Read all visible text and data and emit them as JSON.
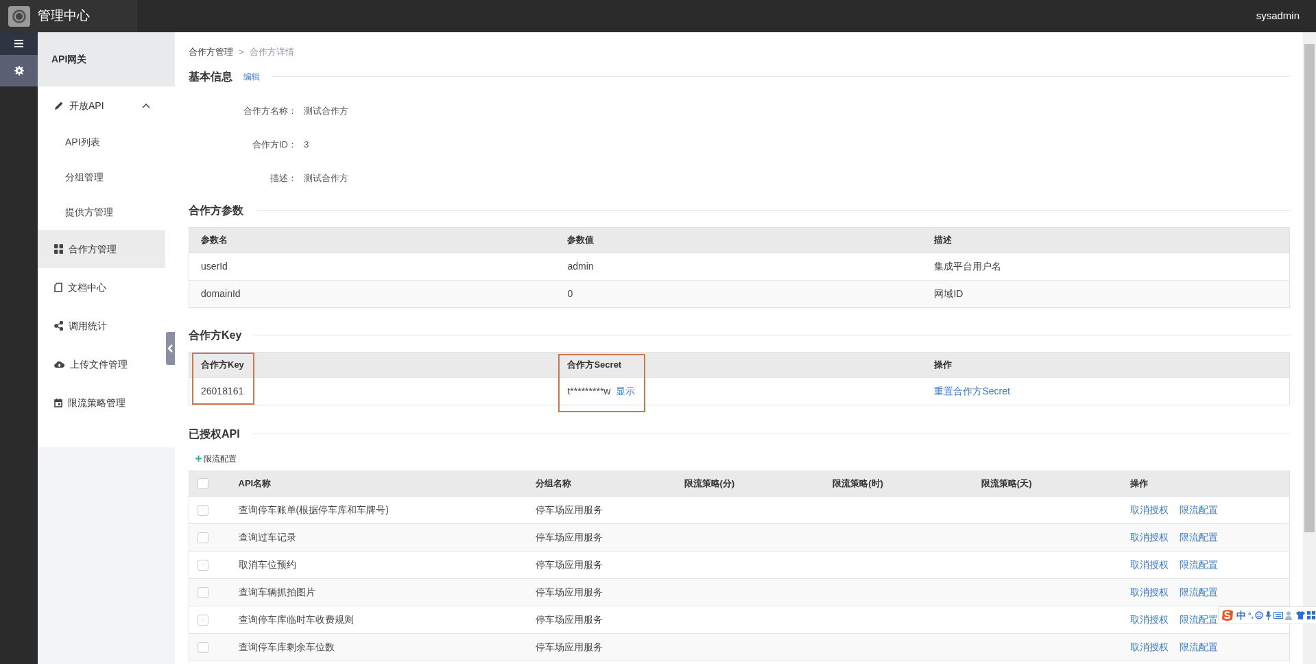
{
  "header": {
    "title": "管理中心",
    "user": "sysadmin"
  },
  "rail": [
    {
      "selected": false
    },
    {
      "selected": true
    }
  ],
  "sidebar": {
    "title": "API网关",
    "items": [
      {
        "label": "开放API",
        "selected": false,
        "expanded": true,
        "children": [
          {
            "label": "API列表",
            "selected": false
          },
          {
            "label": "分组管理",
            "selected": false
          },
          {
            "label": "提供方管理",
            "selected": false
          }
        ]
      },
      {
        "label": "合作方管理",
        "selected": true
      },
      {
        "label": "文档中心",
        "selected": false
      },
      {
        "label": "调用统计",
        "selected": false
      },
      {
        "label": "上传文件管理",
        "selected": false
      },
      {
        "label": "限流策略管理",
        "selected": false
      }
    ]
  },
  "breadcrumb": {
    "separator": ">",
    "items": [
      {
        "label": "合作方管理",
        "current": false
      },
      {
        "label": "合作方详情",
        "current": true
      }
    ]
  },
  "basic_info": {
    "title": "基本信息",
    "action": "编辑",
    "fields": [
      {
        "label": "合作方名称：",
        "value": "测试合作方"
      },
      {
        "label": "合作方ID：",
        "value": "3"
      },
      {
        "label": "描述：",
        "value": "测试合作方"
      }
    ]
  },
  "params": {
    "title": "合作方参数",
    "columns": [
      "参数名",
      "参数值",
      "描述"
    ],
    "rows": [
      [
        "userId",
        "admin",
        "集成平台用户名"
      ],
      [
        "domainId",
        "0",
        "网域ID"
      ]
    ]
  },
  "key_section": {
    "title": "合作方Key",
    "columns": [
      {
        "label": "合作方Key",
        "highlighted": true
      },
      {
        "label": "合作方Secret",
        "highlighted": true
      },
      {
        "label": "操作",
        "highlighted": false
      }
    ],
    "row": {
      "key": "26018161",
      "secret": "t*********w",
      "show": "显示",
      "reset": "重置合作方Secret"
    }
  },
  "authorized": {
    "title": "已授权API",
    "add_button": "限流配置",
    "header_checked": false,
    "columns": [
      "API名称",
      "分组名称",
      "限流策略(分)",
      "限流策略(时)",
      "限流策略(天)",
      "操作"
    ],
    "rows": [
      {
        "checked": false,
        "name": "查询停车账单(根据停车库和车牌号)",
        "group": "停车场应用服务",
        "actions": [
          "取消授权",
          "限流配置"
        ]
      },
      {
        "checked": false,
        "name": "查询过车记录",
        "group": "停车场应用服务",
        "actions": [
          "取消授权",
          "限流配置"
        ]
      },
      {
        "checked": false,
        "name": "取消车位预约",
        "group": "停车场应用服务",
        "actions": [
          "取消授权",
          "限流配置"
        ]
      },
      {
        "checked": false,
        "name": "查询车辆抓拍图片",
        "group": "停车场应用服务",
        "actions": [
          "取消授权",
          "限流配置"
        ]
      },
      {
        "checked": false,
        "name": "查询停车库临时车收费规则",
        "group": "停车场应用服务",
        "actions": [
          "取消授权",
          "限流配置"
        ]
      },
      {
        "checked": false,
        "name": "查询停车库剩余车位数",
        "group": "停车场应用服务",
        "actions": [
          "取消授权",
          "限流配置"
        ]
      }
    ]
  },
  "ime_bar": {
    "mode": "中",
    "punctuation": "°,"
  }
}
